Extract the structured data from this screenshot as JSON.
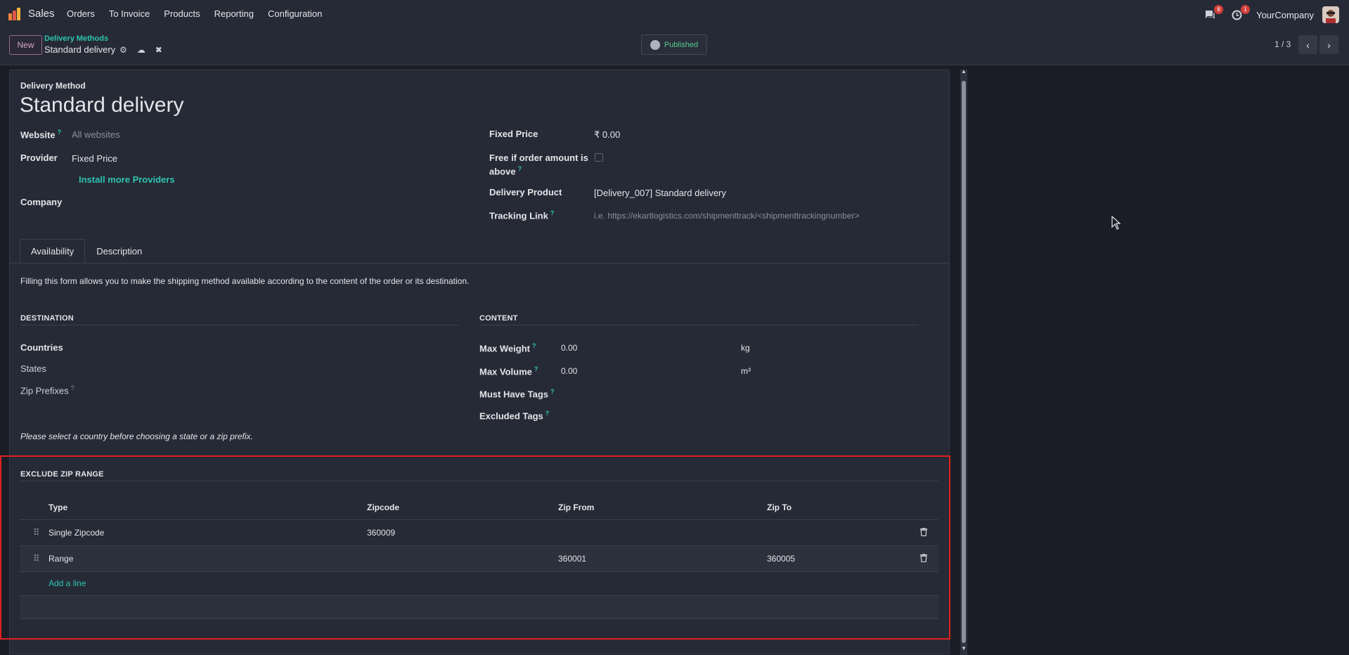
{
  "navbar": {
    "app_name": "Sales",
    "menu": [
      "Orders",
      "To Invoice",
      "Products",
      "Reporting",
      "Configuration"
    ],
    "messages_badge": "8",
    "activity_badge": "1",
    "company": "YourCompany"
  },
  "control": {
    "new_label": "New",
    "breadcrumb": "Delivery Methods",
    "record_title": "Standard delivery",
    "published_label": "Published",
    "pager": "1 / 3"
  },
  "form": {
    "header_label": "Delivery Method",
    "name": "Standard delivery",
    "left": {
      "website_label": "Website",
      "website_placeholder": "All websites",
      "provider_label": "Provider",
      "provider_value": "Fixed Price",
      "install_link": "Install more Providers",
      "company_label": "Company"
    },
    "right": {
      "fixed_price_label": "Fixed Price",
      "fixed_price_value": "₹ 0.00",
      "free_if_label_1": "Free if order amount is",
      "free_if_label_2": "above",
      "delivery_product_label": "Delivery Product",
      "delivery_product_value": "[Delivery_007] Standard delivery",
      "tracking_link_label": "Tracking Link",
      "tracking_link_placeholder": "i.e. https://ekartlogistics.com/shipmenttrack/<shipmenttrackingnumber>"
    }
  },
  "tabs": [
    "Availability",
    "Description"
  ],
  "availability": {
    "intro": "Filling this form allows you to make the shipping method available according to the content of the order or its destination.",
    "destination_title": "DESTINATION",
    "countries_label": "Countries",
    "states_label": "States",
    "zip_prefixes_label": "Zip Prefixes",
    "content_title": "CONTENT",
    "max_weight_label": "Max Weight",
    "max_weight_value": "0.00",
    "max_weight_unit": "kg",
    "max_volume_label": "Max Volume",
    "max_volume_value": "0.00",
    "max_volume_unit": "m³",
    "must_have_tags_label": "Must Have Tags",
    "excluded_tags_label": "Excluded Tags",
    "note": "Please select a country before choosing a state or a zip prefix."
  },
  "exclude_zip": {
    "title": "EXCLUDE ZIP RANGE",
    "headers": [
      "Type",
      "Zipcode",
      "Zip From",
      "Zip To"
    ],
    "rows": [
      {
        "type": "Single Zipcode",
        "zipcode": "360009",
        "zip_from": "",
        "zip_to": ""
      },
      {
        "type": "Range",
        "zipcode": "",
        "zip_from": "360001",
        "zip_to": "360005"
      }
    ],
    "add_line": "Add a line"
  },
  "colors": {
    "accent": "#2ec4b0",
    "published": "#58c98c",
    "highlight": "#e02020"
  }
}
